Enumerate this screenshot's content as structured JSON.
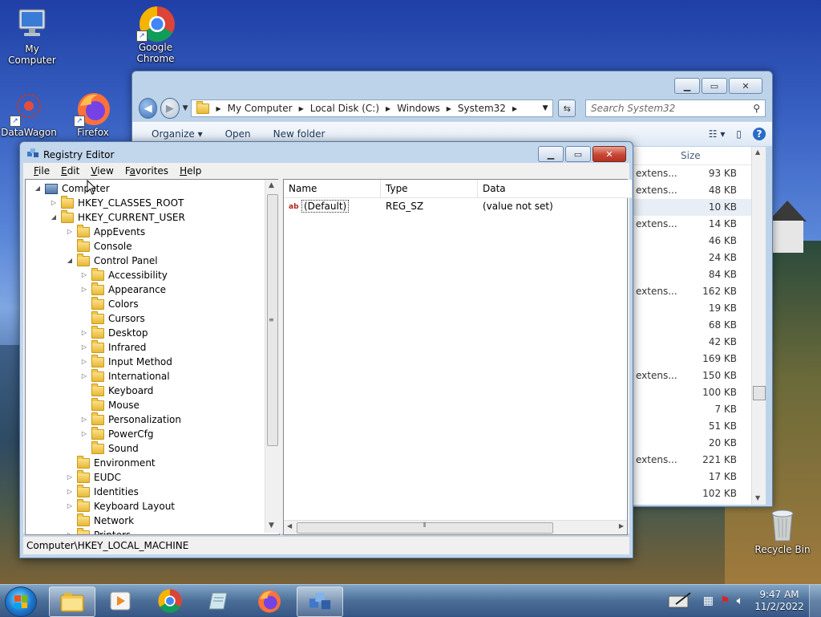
{
  "desktop": {
    "icons": [
      {
        "label": "My Computer"
      },
      {
        "label": "Google\nChrome"
      },
      {
        "label": "DataWagon"
      },
      {
        "label": "Firefox"
      },
      {
        "label": "Recycle Bin"
      }
    ]
  },
  "explorer": {
    "breadcrumb": [
      "My Computer",
      "Local Disk (C:)",
      "Windows",
      "System32"
    ],
    "search_placeholder": "Search System32",
    "toolbar": {
      "organize": "Organize ▾",
      "open": "Open",
      "new_folder": "New folder"
    },
    "size_header": "Size",
    "rows": [
      {
        "type": "extens...",
        "size": "93 KB"
      },
      {
        "type": "extens...",
        "size": "48 KB"
      },
      {
        "type": "",
        "size": "10 KB",
        "selected": true
      },
      {
        "type": "extens...",
        "size": "14 KB"
      },
      {
        "type": "",
        "size": "46 KB"
      },
      {
        "type": "",
        "size": "24 KB"
      },
      {
        "type": "",
        "size": "84 KB"
      },
      {
        "type": "extens...",
        "size": "162 KB"
      },
      {
        "type": "",
        "size": "19 KB"
      },
      {
        "type": "",
        "size": "68 KB"
      },
      {
        "type": "",
        "size": "42 KB"
      },
      {
        "type": "",
        "size": "169 KB"
      },
      {
        "type": "extens...",
        "size": "150 KB"
      },
      {
        "type": "",
        "size": "100 KB"
      },
      {
        "type": "",
        "size": "7 KB"
      },
      {
        "type": "",
        "size": "51 KB"
      },
      {
        "type": "",
        "size": "20 KB"
      },
      {
        "type": "extens...",
        "size": "221 KB"
      },
      {
        "type": "",
        "size": "17 KB"
      },
      {
        "type": "",
        "size": "102 KB"
      }
    ]
  },
  "regedit": {
    "title": "Registry Editor",
    "menu": [
      {
        "label": "File",
        "u": "F",
        "rest": "ile"
      },
      {
        "label": "Edit",
        "u": "E",
        "rest": "dit"
      },
      {
        "label": "View",
        "u": "V",
        "rest": "iew"
      },
      {
        "label": "Favorites",
        "u": "a",
        "pre": "F",
        "rest": "vorites"
      },
      {
        "label": "Help",
        "u": "H",
        "rest": "elp"
      }
    ],
    "tree": [
      {
        "label": "Computer",
        "level": 0,
        "toggle": "open",
        "icon": "computer"
      },
      {
        "label": "HKEY_CLASSES_ROOT",
        "level": 1,
        "toggle": "closed"
      },
      {
        "label": "HKEY_CURRENT_USER",
        "level": 1,
        "toggle": "open"
      },
      {
        "label": "AppEvents",
        "level": 2,
        "toggle": "closed"
      },
      {
        "label": "Console",
        "level": 2,
        "toggle": "none"
      },
      {
        "label": "Control Panel",
        "level": 2,
        "toggle": "open"
      },
      {
        "label": "Accessibility",
        "level": 3,
        "toggle": "closed"
      },
      {
        "label": "Appearance",
        "level": 3,
        "toggle": "closed"
      },
      {
        "label": "Colors",
        "level": 3,
        "toggle": "none"
      },
      {
        "label": "Cursors",
        "level": 3,
        "toggle": "none"
      },
      {
        "label": "Desktop",
        "level": 3,
        "toggle": "closed"
      },
      {
        "label": "Infrared",
        "level": 3,
        "toggle": "closed"
      },
      {
        "label": "Input Method",
        "level": 3,
        "toggle": "closed"
      },
      {
        "label": "International",
        "level": 3,
        "toggle": "closed"
      },
      {
        "label": "Keyboard",
        "level": 3,
        "toggle": "none"
      },
      {
        "label": "Mouse",
        "level": 3,
        "toggle": "none"
      },
      {
        "label": "Personalization",
        "level": 3,
        "toggle": "closed"
      },
      {
        "label": "PowerCfg",
        "level": 3,
        "toggle": "closed"
      },
      {
        "label": "Sound",
        "level": 3,
        "toggle": "none"
      },
      {
        "label": "Environment",
        "level": 2,
        "toggle": "none"
      },
      {
        "label": "EUDC",
        "level": 2,
        "toggle": "closed"
      },
      {
        "label": "Identities",
        "level": 2,
        "toggle": "closed"
      },
      {
        "label": "Keyboard Layout",
        "level": 2,
        "toggle": "closed"
      },
      {
        "label": "Network",
        "level": 2,
        "toggle": "none"
      },
      {
        "label": "Printers",
        "level": 2,
        "toggle": "closed"
      }
    ],
    "columns": [
      "Name",
      "Type",
      "Data"
    ],
    "values": [
      {
        "name": "(Default)",
        "type": "REG_SZ",
        "data": "(value not set)"
      }
    ],
    "status": "Computer\\HKEY_LOCAL_MACHINE"
  },
  "taskbar": {
    "time": "9:47 AM",
    "date": "11/2/2022"
  }
}
